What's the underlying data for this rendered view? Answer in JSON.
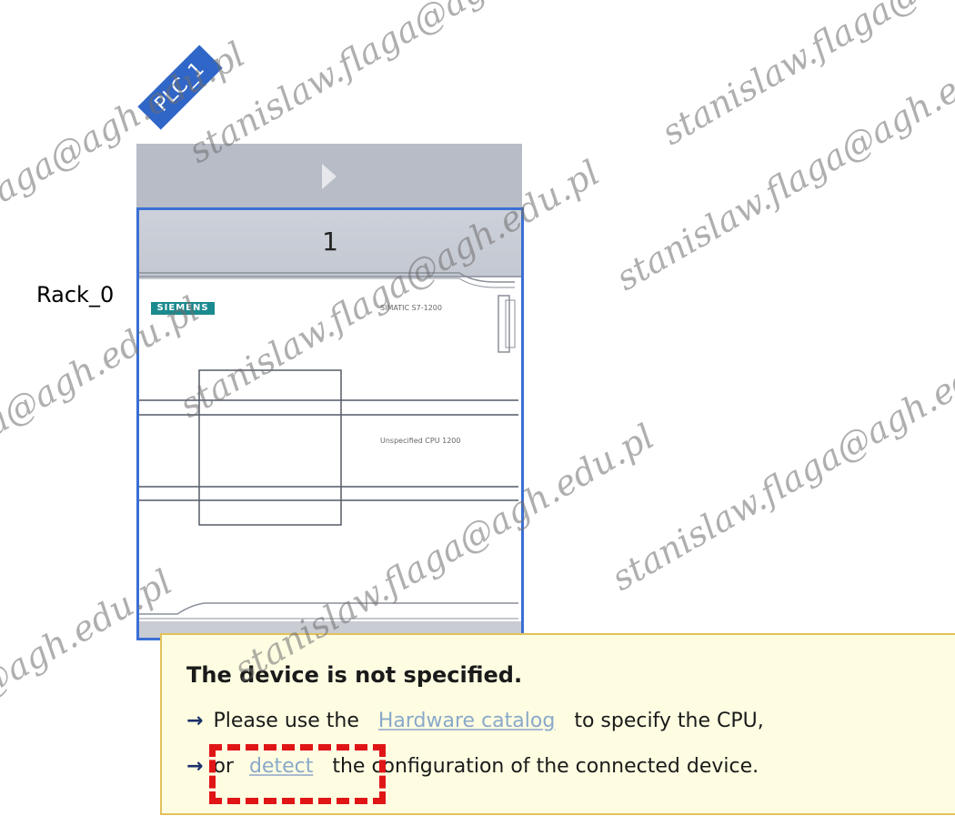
{
  "device": {
    "plc_tag": "PLC_1",
    "slot_number": "1",
    "rack_label": "Rack_0",
    "brand_logo": "SIEMENS",
    "model_text": "SIMATIC S7-1200",
    "cpu_text": "Unspecified CPU 1200"
  },
  "tooltip": {
    "title": "The device is not specified.",
    "line1_prefix": "Please use the",
    "line1_link": "Hardware catalog",
    "line1_suffix": "to specify the CPU,",
    "line2_prefix": "or",
    "line2_link": "detect",
    "line2_suffix": "the configuration of the connected device."
  },
  "watermark": {
    "text": "stanislaw.flaga@agh.edu.pl"
  },
  "icons": {
    "rack_arrow": "play-arrow-icon",
    "bullet_arrow": "arrow-right-icon"
  },
  "colors": {
    "plc_tag": "#2f66c8",
    "slot_border": "#3b6fd4",
    "tooltip_bg": "#fefde2",
    "tooltip_border": "#e3c15a",
    "link": "#8aa9c9",
    "highlight": "#e01515"
  }
}
